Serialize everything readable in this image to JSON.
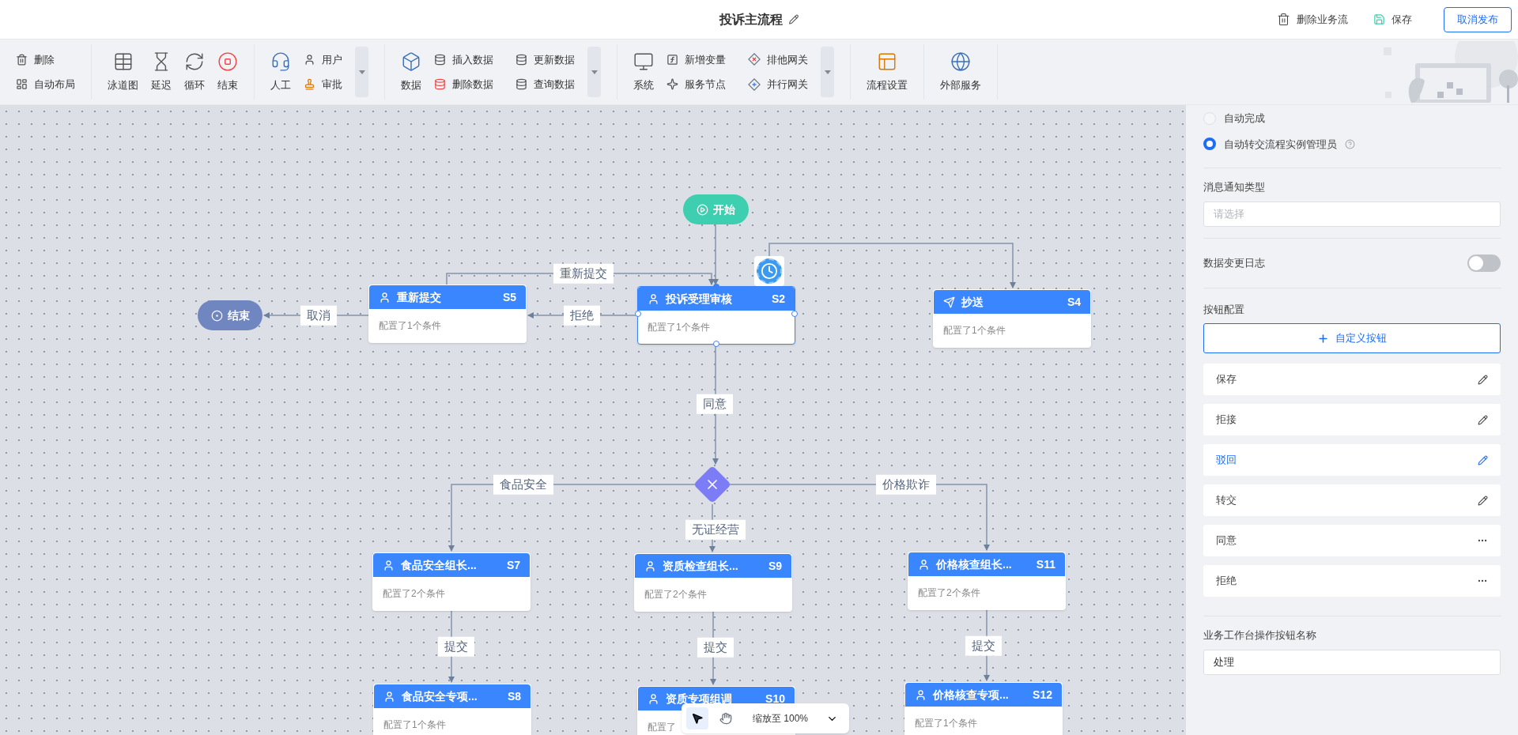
{
  "header": {
    "title": "投诉主流程",
    "actions": [
      {
        "kind": "delete",
        "label": "删除业务流"
      },
      {
        "kind": "save",
        "label": "保存"
      }
    ],
    "publish_button": "取消发布"
  },
  "toolbar": {
    "groups": [
      {
        "small": [
          "删除",
          "自动布局"
        ],
        "has_more": false
      },
      {
        "large": [
          "泳道图",
          "延迟",
          "循环",
          "结束"
        ],
        "has_more": false
      },
      {
        "large": [
          "人工"
        ],
        "small": [
          "用户",
          "审批"
        ],
        "has_more": true
      },
      {
        "large": [
          "数据"
        ],
        "small": [
          "插入数据",
          "删除数据",
          "更新数据",
          "查询数据"
        ],
        "has_more": true
      },
      {
        "large": [
          "系统"
        ],
        "small": [
          "新增变量",
          "服务节点",
          "排他网关",
          "并行网关"
        ],
        "has_more": true
      },
      {
        "large": [
          "流程设置"
        ],
        "has_more": false
      },
      {
        "large": [
          "外部服务"
        ],
        "has_more": false
      }
    ]
  },
  "canvas": {
    "nodes": [
      {
        "kind": "start",
        "label": "开始"
      },
      {
        "kind": "end",
        "label": "结束"
      },
      {
        "kind": "user_task",
        "label": "重新提交",
        "badge": "S5",
        "subtitle": "配置了1个条件",
        "selected": false,
        "timer": false
      },
      {
        "kind": "user_task",
        "label": "投诉受理审核",
        "badge": "S2",
        "subtitle": "配置了1个条件",
        "selected": true,
        "timer": true
      },
      {
        "kind": "cc_task",
        "label": "抄送",
        "badge": "S4",
        "subtitle": "配置了1个条件",
        "selected": false,
        "timer": false
      },
      {
        "kind": "user_task",
        "label": "食品安全组长...",
        "badge": "S7",
        "subtitle": "配置了2个条件",
        "selected": false,
        "timer": false
      },
      {
        "kind": "user_task",
        "label": "资质检查组长...",
        "badge": "S9",
        "subtitle": "配置了2个条件",
        "selected": false,
        "timer": false
      },
      {
        "kind": "user_task",
        "label": "价格核查组长...",
        "badge": "S11",
        "subtitle": "配置了2个条件",
        "selected": false,
        "timer": false
      },
      {
        "kind": "user_task",
        "label": "食品安全专项...",
        "badge": "S8",
        "subtitle": "配置了1个条件",
        "selected": false,
        "timer": false
      },
      {
        "kind": "user_task",
        "label": "资质专项组调",
        "badge": "S10",
        "subtitle": "配置了",
        "selected": false,
        "timer": false
      },
      {
        "kind": "user_task",
        "label": "价格核查专项...",
        "badge": "S12",
        "subtitle": "配置了1个条件",
        "selected": false,
        "timer": false
      },
      {
        "kind": "gateway"
      }
    ],
    "edges": [
      {
        "label": "重新提交"
      },
      {
        "label": "拒绝"
      },
      {
        "label": "取消"
      },
      {
        "label": "同意"
      },
      {
        "label": "食品安全"
      },
      {
        "label": "无证经营"
      },
      {
        "label": "价格欺诈"
      },
      {
        "label": "提交"
      },
      {
        "label": "提交"
      },
      {
        "label": "提交"
      }
    ],
    "zoom_bar": {
      "tools": [
        {
          "kind": "select",
          "selected": true
        },
        {
          "kind": "pan",
          "selected": false
        }
      ],
      "zoom_label": "缩放至 100%"
    }
  },
  "panel": {
    "radios": [
      {
        "label": "自动完成",
        "selected": false
      },
      {
        "label": "自动转交流程实例管理员",
        "selected": true
      }
    ],
    "notify": {
      "label": "消息通知类型",
      "placeholder": "请选择"
    },
    "change_log": {
      "label": "数据变更日志",
      "on": false
    },
    "button_config": {
      "label": "按钮配置",
      "add_button": "自定义按钮",
      "items": [
        {
          "label": "保存",
          "kind": "edit",
          "selected": false
        },
        {
          "label": "拒接",
          "kind": "edit",
          "selected": false
        },
        {
          "label": "驳回",
          "kind": "edit",
          "selected": true
        },
        {
          "label": "转交",
          "kind": "edit",
          "selected": false
        },
        {
          "label": "同意",
          "kind": "more",
          "selected": false
        },
        {
          "label": "拒绝",
          "kind": "more",
          "selected": false
        }
      ]
    },
    "workbench": {
      "label": "业务工作台操作按钮名称",
      "value": "处理"
    }
  }
}
